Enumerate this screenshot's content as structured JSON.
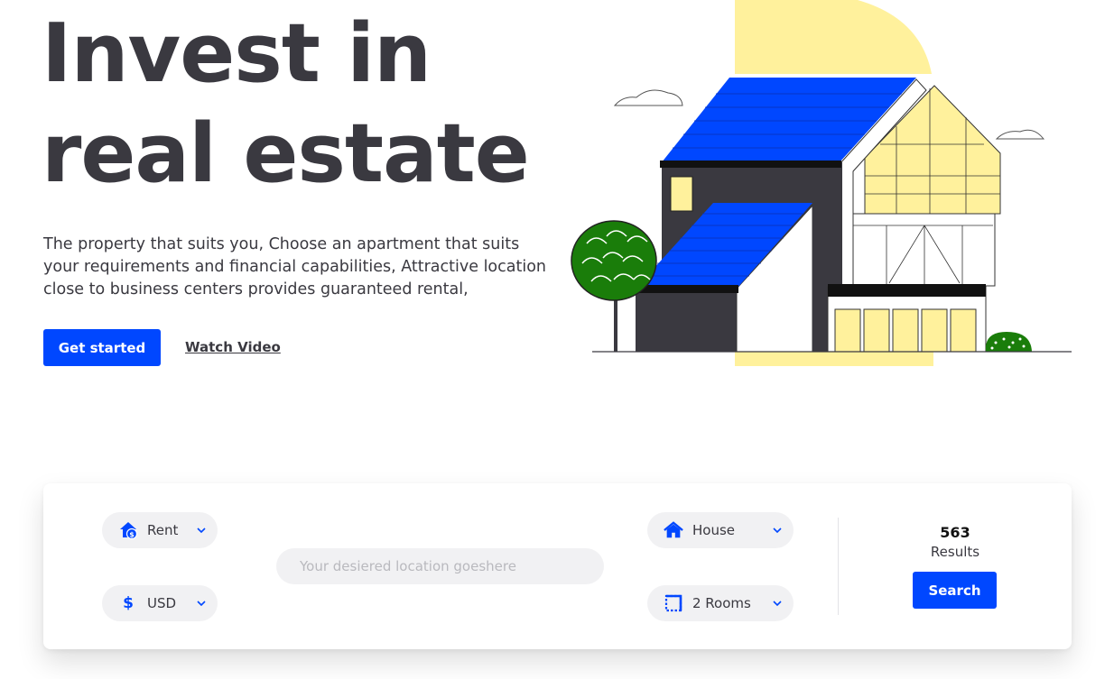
{
  "hero": {
    "title_line1": "Invest in",
    "title_line2": "real estate",
    "description": "The property that suits you, Choose an apartment that suits your requirements and financial capabilities, Attractive location close to business centers provides guaranteed rental,",
    "primary_button": "Get started",
    "secondary_link": "Watch Video"
  },
  "search": {
    "listing_type": {
      "value": "Rent",
      "icon": "home-dollar-icon"
    },
    "currency": {
      "value": "USD",
      "icon": "dollar-icon",
      "symbol": "$"
    },
    "location": {
      "placeholder": "Your desiered location goeshere"
    },
    "property_type": {
      "value": "House",
      "icon": "house-icon"
    },
    "rooms": {
      "value": "2 Rooms",
      "icon": "floorplan-icon"
    },
    "results_count": "563",
    "results_label": "Results",
    "search_button": "Search"
  },
  "colors": {
    "accent": "#0047ff",
    "text": "#3a3940",
    "illustration_yellow": "#fff19c",
    "illustration_green": "#1a7d0a"
  }
}
